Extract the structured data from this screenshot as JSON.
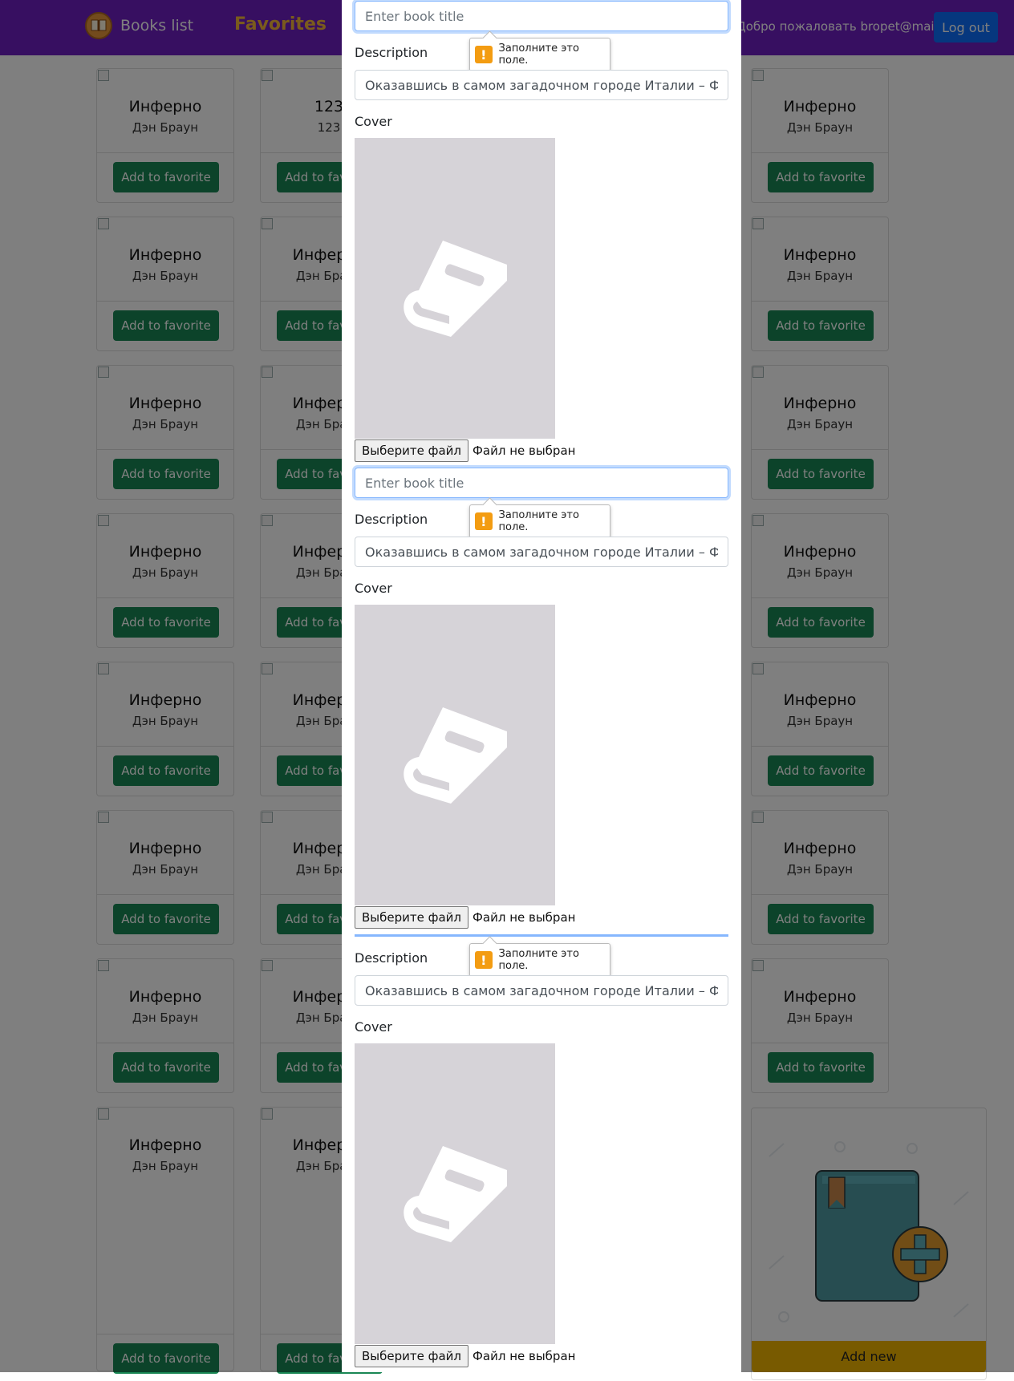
{
  "navbar": {
    "brand": "Books list",
    "favorites": "Favorites",
    "welcome": "Добро пожаловать bropet@mail.ru",
    "logout": "Log out"
  },
  "card": {
    "title": "Инферно",
    "author": "Дэн Браун",
    "alt_title": "123",
    "alt_author": "123",
    "button": "Add to favorite"
  },
  "add_new": {
    "button": "Add new"
  },
  "colors": {
    "navbar": "#6f1ec2",
    "favorites_link": "#f4b63a",
    "favorite_button": "#198754",
    "add_new_button": "#f0b400",
    "logout_button": "#0d6efd",
    "cover_placeholder": "#d6d3d8"
  },
  "modal": {
    "title_placeholder": "Enter book title",
    "description_label": "Description",
    "description_value": "Оказавшись в самом загадочном городе Италии – Флоренция",
    "cover_label": "Cover",
    "file_button": "Выберите файл",
    "file_status": "Файл не выбран",
    "validation_tooltip": "Заполните это поле."
  },
  "icons": {
    "brand": "book-logo-icon",
    "cover": "book-icon",
    "warning": "warning-icon",
    "add_book": "add-book-icon"
  }
}
